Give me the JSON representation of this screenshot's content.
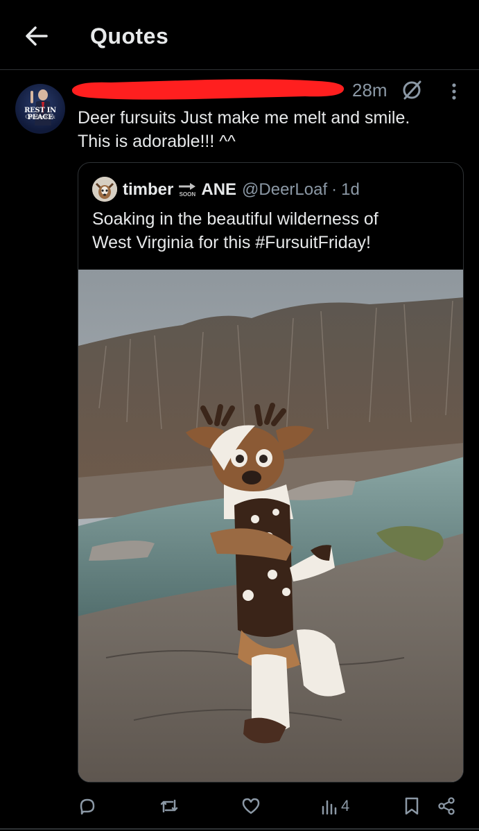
{
  "header": {
    "back_icon": "back-arrow-icon",
    "title": "Quotes"
  },
  "post": {
    "avatar_caption": "REST IN PEACE",
    "avatar_subcaption": "Charlie Kirk",
    "time": "28m",
    "text_line1": "Deer fursuits Just make me melt and smile.",
    "text_line2": "This is adorable!!! ^^",
    "redaction_color": "#ff1f1f",
    "icons": [
      "grok-icon",
      "more-vertical-icon"
    ]
  },
  "quoted": {
    "name_part1": "timber",
    "soon_label": "SOON",
    "name_part2": "ANE",
    "handle": "@DeerLoaf",
    "separator": "·",
    "age": "1d",
    "text_line1": "Soaking in the beautiful wilderness of",
    "text_line2": "West Virginia for this #FursuitFriday!"
  },
  "actions": {
    "views_count": "4",
    "icons": [
      "reply-icon",
      "repost-icon",
      "like-icon",
      "views-icon",
      "bookmark-icon",
      "share-icon"
    ]
  },
  "colors": {
    "background": "#000000",
    "text": "#e7e9ea",
    "secondary": "#8b98a5",
    "divider": "#2f3336"
  }
}
